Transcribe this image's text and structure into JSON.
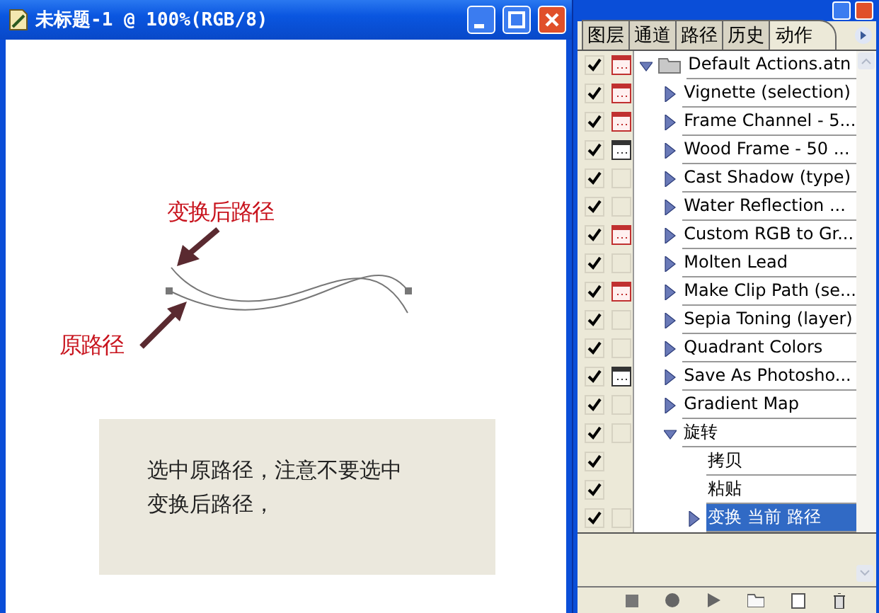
{
  "document_window": {
    "title": "未标题-1 @ 100%(RGB/8)",
    "labels": [
      {
        "kind": "transformed",
        "text": "变换后路径"
      },
      {
        "kind": "original",
        "text": "原路径"
      }
    ],
    "note": "选中原路径，注意不要选中变换后路径，"
  },
  "panel": {
    "tabs": [
      {
        "label": "图层",
        "selected": false
      },
      {
        "label": "通道",
        "selected": false
      },
      {
        "label": "路径",
        "selected": false
      },
      {
        "label": "历史",
        "selected": false
      },
      {
        "label": "动作",
        "selected": true
      }
    ],
    "actions": [
      {
        "name": "Default Actions.atn",
        "checked": true,
        "dialog_on": true,
        "dialog_partial": true,
        "expanded": true,
        "selected": false,
        "children": [
          {
            "name": "Vignette (selection)",
            "checked": true,
            "dialog_on": true,
            "dialog_partial": true,
            "expanded": false,
            "selected": false
          },
          {
            "name": "Frame Channel - 5...",
            "checked": true,
            "dialog_on": true,
            "dialog_partial": true,
            "expanded": false,
            "selected": false
          },
          {
            "name": "Wood Frame - 50 ...",
            "checked": true,
            "dialog_on": true,
            "dialog_partial": false,
            "expanded": false,
            "selected": false
          },
          {
            "name": "Cast Shadow (type)",
            "checked": true,
            "dialog_on": false,
            "expanded": false,
            "selected": false
          },
          {
            "name": "Water Reflection ...",
            "checked": true,
            "dialog_on": false,
            "expanded": false,
            "selected": false
          },
          {
            "name": "Custom RGB to Gr...",
            "checked": true,
            "dialog_on": true,
            "dialog_partial": true,
            "expanded": false,
            "selected": false
          },
          {
            "name": "Molten Lead",
            "checked": true,
            "dialog_on": false,
            "expanded": false,
            "selected": false
          },
          {
            "name": "Make Clip Path (se...",
            "checked": true,
            "dialog_on": true,
            "dialog_partial": true,
            "expanded": false,
            "selected": false
          },
          {
            "name": "Sepia Toning (layer)",
            "checked": true,
            "dialog_on": false,
            "expanded": false,
            "selected": false
          },
          {
            "name": "Quadrant Colors",
            "checked": true,
            "dialog_on": false,
            "expanded": false,
            "selected": false
          },
          {
            "name": "Save As Photosho...",
            "checked": true,
            "dialog_on": true,
            "dialog_partial": false,
            "expanded": false,
            "selected": false
          },
          {
            "name": "Gradient Map",
            "checked": true,
            "dialog_on": false,
            "expanded": false,
            "selected": false
          },
          {
            "name": "旋转",
            "checked": true,
            "dialog_on": false,
            "expanded": true,
            "selected": false,
            "children": [
              {
                "name": "拷贝",
                "checked": true,
                "selected": false
              },
              {
                "name": "粘贴",
                "checked": true,
                "selected": false
              },
              {
                "name": "变换 当前 路径",
                "checked": true,
                "dialog_on": false,
                "expanded": false,
                "selected": true
              }
            ]
          }
        ]
      }
    ]
  }
}
